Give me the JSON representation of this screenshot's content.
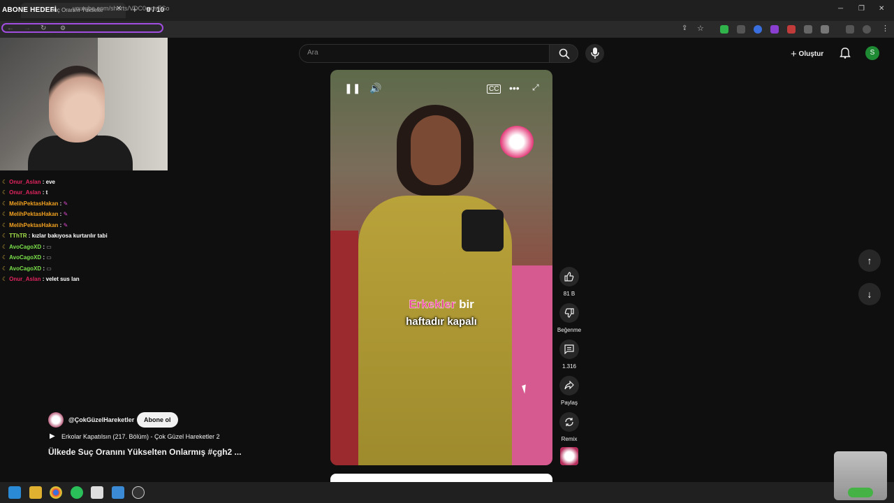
{
  "browser": {
    "tab_title": "Suç Oranını Yükselte",
    "url": "youtube.com/shorts/VDC0gxtsESo"
  },
  "overlay": {
    "goal_label": "ABONE HEDEFİ",
    "goal_counter": "0 / 10"
  },
  "chat": {
    "messages": [
      {
        "user": "Onur_Aslan",
        "text": ": eve",
        "color": "#e0245e"
      },
      {
        "user": "Onur_Aslan",
        "text": ": t",
        "color": "#e0245e"
      },
      {
        "user": "MelihPektasHakan",
        "text": ":",
        "color": "#f0a020"
      },
      {
        "user": "MelihPektasHakan",
        "text": ":",
        "color": "#f0a020"
      },
      {
        "user": "MelihPektasHakan",
        "text": ":",
        "color": "#f0a020"
      },
      {
        "user": "TThTR",
        "text": ": kızlar bakıyosa kurtarılır tabi",
        "color": "#a6e34a"
      },
      {
        "user": "AvoCagoXD",
        "text": ":",
        "color": "#7be04a"
      },
      {
        "user": "AvoCagoXD",
        "text": ":",
        "color": "#7be04a"
      },
      {
        "user": "AvoCagoXD",
        "text": ":",
        "color": "#7be04a"
      },
      {
        "user": "Onur_Aslan",
        "text": ": velet sus lan",
        "color": "#e0245e"
      }
    ]
  },
  "youtube": {
    "search_placeholder": "Ara",
    "create_label": "Oluştur",
    "avatar_letter": "S"
  },
  "video": {
    "caption_highlight": "Erkekler",
    "caption_rest": "bir",
    "caption_line2": "haftadır kapalı"
  },
  "actions": {
    "like_count": "81 B",
    "dislike_label": "Beğenme",
    "comment_count": "1.316",
    "share_label": "Paylaş",
    "remix_label": "Remix"
  },
  "channel": {
    "name": "@ÇokGüzelHareketler",
    "subscribe_label": "Abone ol",
    "playlist": "Erkolar Kapatılsın (217. Bölüm) - Çok Güzel Hareketler 2",
    "title": "Ülkede Suç Oranını Yükselten Onlarmış #çgh2 ..."
  },
  "colors": {
    "accent_purple": "#a14de0",
    "caption_pink": "#e8338a",
    "avatar_green": "#1e8a34"
  }
}
